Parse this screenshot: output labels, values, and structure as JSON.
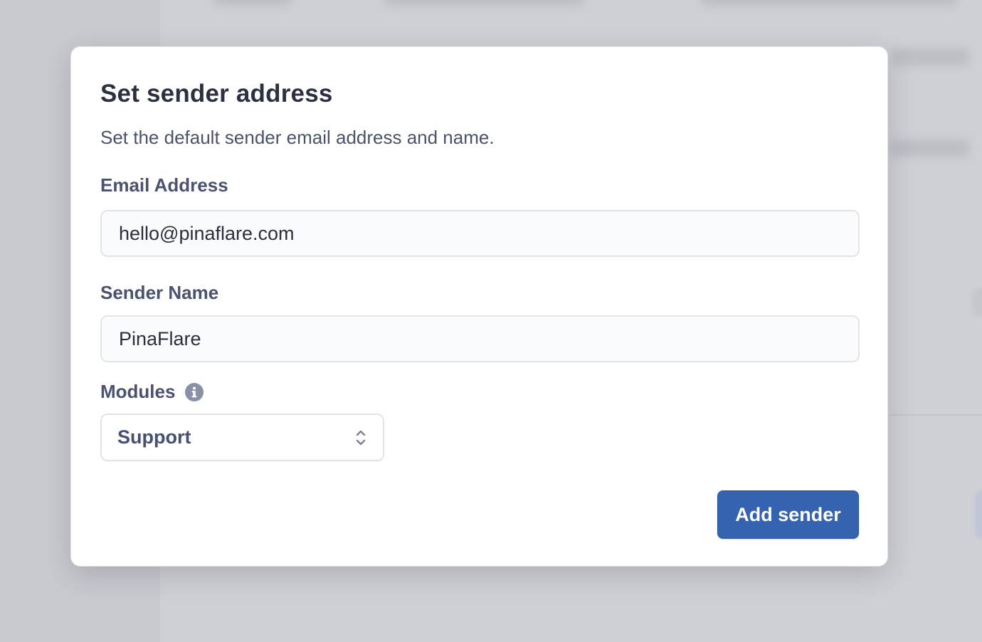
{
  "modal": {
    "title": "Set sender address",
    "description": "Set the default sender email address and name."
  },
  "form": {
    "email": {
      "label": "Email Address",
      "value": "hello@pinaflare.com"
    },
    "sender_name": {
      "label": "Sender Name",
      "value": "PinaFlare"
    },
    "modules": {
      "label": "Modules",
      "info_icon": "info-circle-icon",
      "selected": "Support"
    }
  },
  "actions": {
    "submit_label": "Add sender"
  },
  "colors": {
    "primary_button": "#3563b0",
    "title_text": "#2c3142",
    "label_text": "#4a5270",
    "backdrop": "#cfd0d4"
  }
}
